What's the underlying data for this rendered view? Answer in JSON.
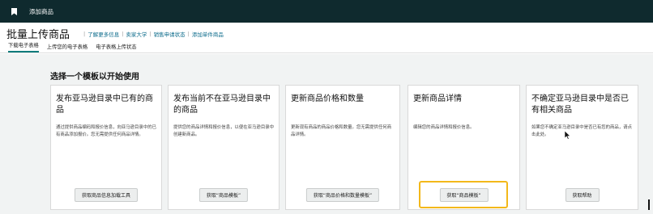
{
  "topbar": {
    "title": "添加商品",
    "icon": "bookmark-icon",
    "bg": "#0f2a2e"
  },
  "header": {
    "page_title": "批量上传商品",
    "links": [
      "了解更多信息",
      "卖家大学",
      "销售申请状态",
      "添加单件商品"
    ]
  },
  "tabs": [
    {
      "label": "下载电子表格",
      "active": true
    },
    {
      "label": "上传您的电子表格",
      "active": false
    },
    {
      "label": "电子表格上传状态",
      "active": false
    }
  ],
  "section_title": "选择一个模板以开始使用",
  "cards": [
    {
      "title": "发布亚马逊目录中已有的商品",
      "description": "通过提供商品编码和报价信息，向亚马逊目录中的已有商品添加报价。您无需提供任何商品详情。",
      "button": "获取商品信息加载工具"
    },
    {
      "title": "发布当前不在亚马逊目录中的商品",
      "description": "提供您的商品详情和报价信息，以便在亚马逊目录中创建新商品。",
      "button": "获取“商品模板”"
    },
    {
      "title": "更新商品价格和数量",
      "description": "更新现有商品的商品价格和数量。您无需提供任何商品详情。",
      "button": "获取“商品价格和数量模板”"
    },
    {
      "title": "更新商品详情",
      "description": "编辑您的商品详情和报价信息。",
      "button": "获取“商品模板”"
    },
    {
      "title": "不确定亚马逊目录中是否已有相关商品",
      "description": "如果您不确定亚马逊目录中是否已有您的商品，请点击此处。",
      "button": "获取帮助"
    }
  ],
  "colors": {
    "highlight": "#f3b81a",
    "tab_underline": "#0a7b7b",
    "link": "#0a6a8a"
  }
}
